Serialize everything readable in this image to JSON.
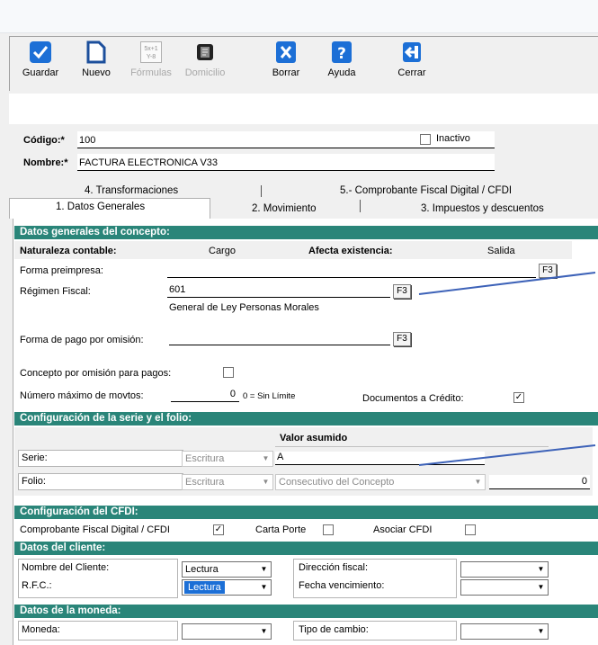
{
  "toolbar": {
    "buttons": [
      {
        "label": "Guardar",
        "icon": "check-icon",
        "enabled": true
      },
      {
        "label": "Nuevo",
        "icon": "new-document-icon",
        "enabled": true
      },
      {
        "label": "Fórmulas",
        "icon": "formula-icon",
        "enabled": false
      },
      {
        "label": "Domicilio",
        "icon": "address-icon",
        "enabled": false
      },
      {
        "label": "Borrar",
        "icon": "delete-icon",
        "enabled": true
      },
      {
        "label": "Ayuda",
        "icon": "help-icon",
        "enabled": true
      },
      {
        "label": "Cerrar",
        "icon": "exit-icon",
        "enabled": true
      }
    ],
    "formula_glyph": "5x+1\nY-8"
  },
  "header": {
    "codigo_label": "Código:*",
    "codigo_value": "100",
    "inactivo_label": "Inactivo",
    "nombre_label": "Nombre:*",
    "nombre_value": "FACTURA ELECTRONICA V33"
  },
  "tabs": {
    "row1": [
      "4. Transformaciones",
      "5.- Comprobante Fiscal Digital / CFDI"
    ],
    "row2": [
      "1. Datos Generales",
      "2. Movimiento",
      "3. Impuestos y descuentos"
    ]
  },
  "datos_generales": {
    "title": "Datos generales del concepto:",
    "naturaleza_label": "Naturaleza contable:",
    "naturaleza_value": "Cargo",
    "afecta_label": "Afecta existencia:",
    "afecta_value": "Salida",
    "forma_preimpresa_label": "Forma preimpresa:",
    "f3": "F3",
    "regimen_label": "Régimen Fiscal:",
    "regimen_value": "601",
    "regimen_desc": "General de Ley Personas Morales",
    "forma_pago_label": "Forma de pago por omisión:",
    "concepto_pagos_label": "Concepto por omisión para pagos:",
    "max_movtos_label": "Número máximo de movtos:",
    "max_movtos_value": "0",
    "sin_limite": "0 = Sin Límite",
    "docs_credito_label": "Documentos a Crédito:",
    "check": "✓"
  },
  "serie_folio": {
    "title": "Configuración de la serie y el folio:",
    "valor_asumido": "Valor asumido",
    "serie_label": "Serie:",
    "serie_mode": "Escritura",
    "serie_value": "A",
    "folio_label": "Folio:",
    "folio_mode": "Escritura",
    "folio_source": "Consecutivo del Concepto",
    "folio_value": "0"
  },
  "cfdi": {
    "title": "Configuración del CFDI:",
    "cfdi_label": "Comprobante Fiscal Digital / CFDI",
    "carta_porte_label": "Carta Porte",
    "asociar_label": "Asociar CFDI"
  },
  "cliente": {
    "title": "Datos del cliente:",
    "nombre_label": "Nombre del Cliente:",
    "nombre_mode": "Lectura",
    "direccion_label": "Dirección fiscal:",
    "rfc_label": "R.F.C.:",
    "rfc_mode": "Lectura",
    "fecha_label": "Fecha vencimiento:"
  },
  "moneda": {
    "title": "Datos de la moneda:",
    "moneda_label": "Moneda:",
    "tipo_cambio_label": "Tipo de cambio:"
  },
  "colors": {
    "section": "#2a8579",
    "accent": "#1c6fd6",
    "pointer_line": "#3d62b8"
  }
}
